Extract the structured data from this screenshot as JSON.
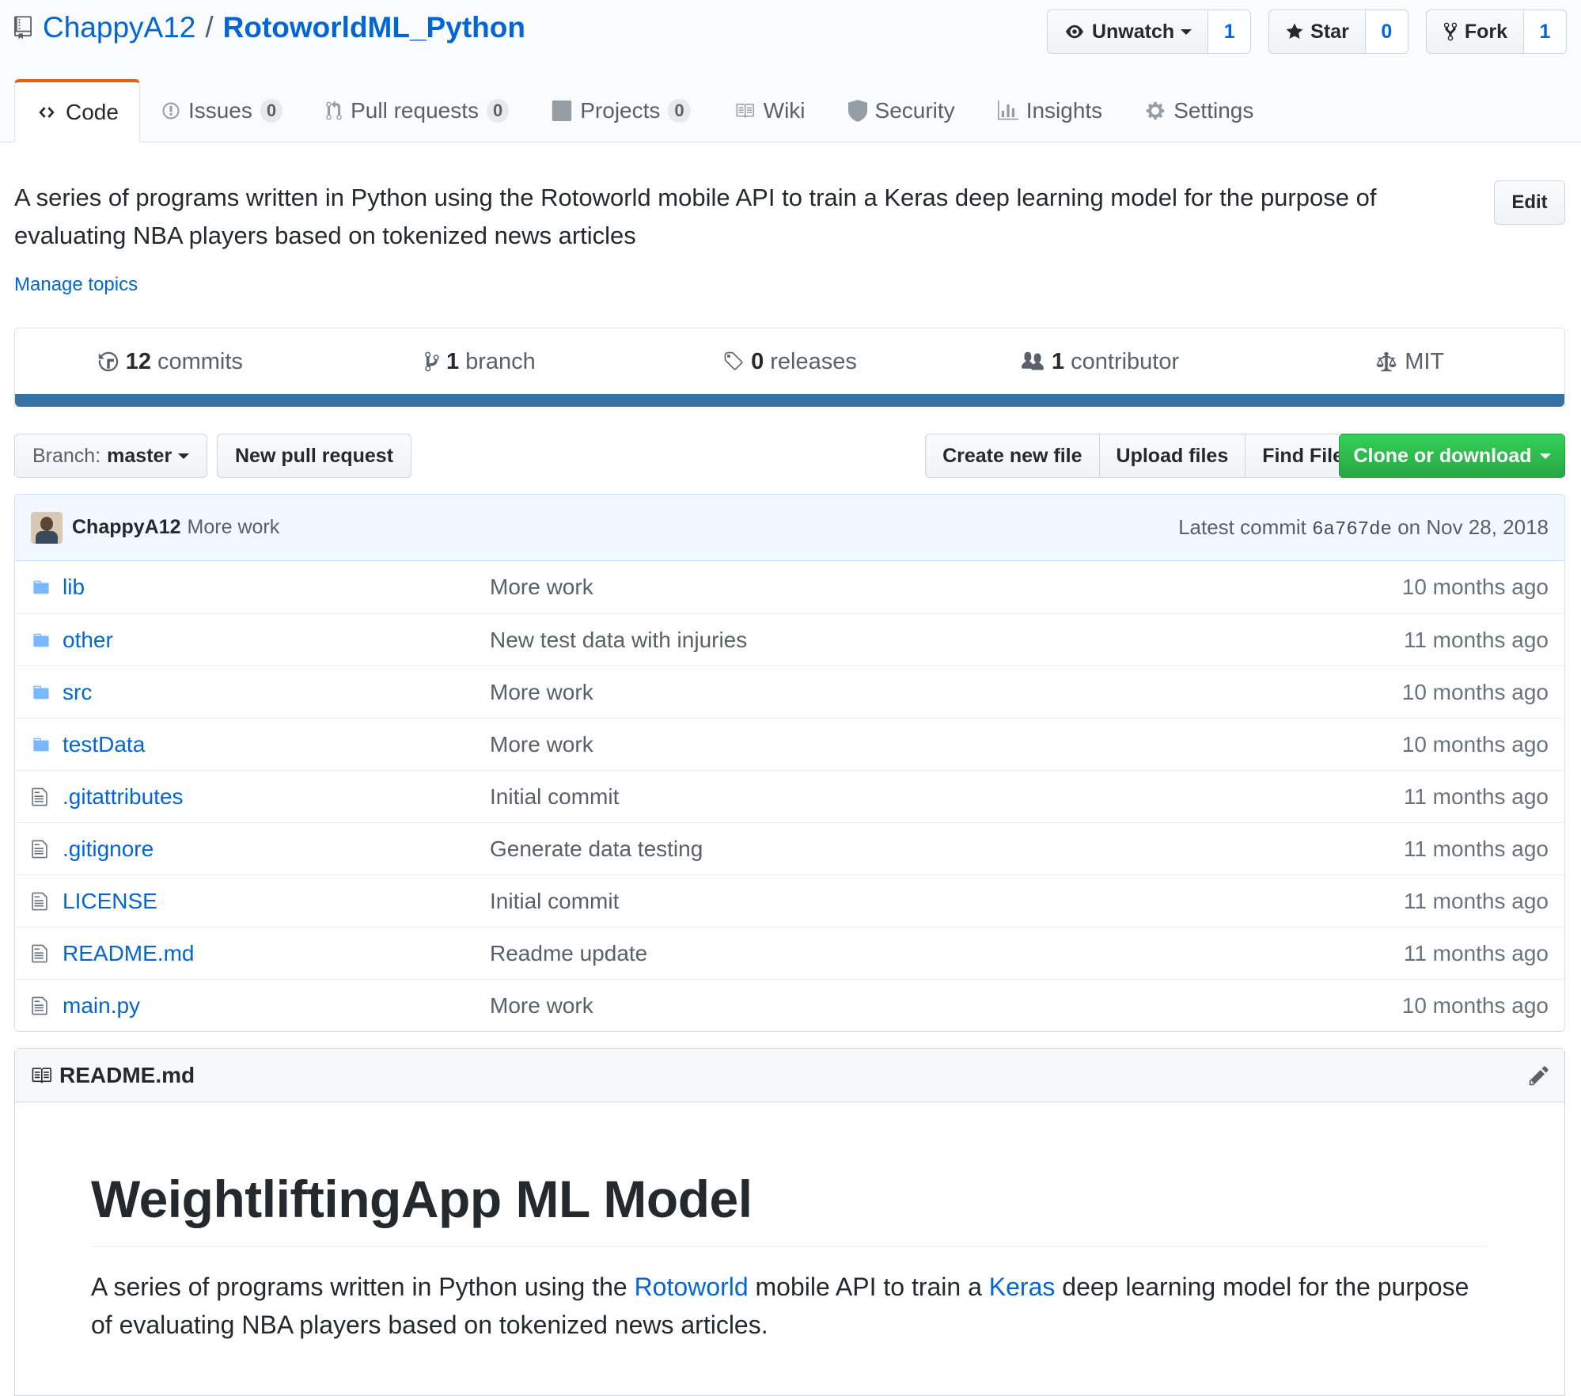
{
  "repo": {
    "owner": "ChappyA12",
    "separator": "/",
    "name": "RotoworldML_Python"
  },
  "actions": {
    "watch": {
      "label": "Unwatch",
      "count": "1"
    },
    "star": {
      "label": "Star",
      "count": "0"
    },
    "fork": {
      "label": "Fork",
      "count": "1"
    }
  },
  "nav": {
    "code": "Code",
    "issues": "Issues",
    "issues_count": "0",
    "pulls": "Pull requests",
    "pulls_count": "0",
    "projects": "Projects",
    "projects_count": "0",
    "wiki": "Wiki",
    "security": "Security",
    "insights": "Insights",
    "settings": "Settings"
  },
  "description": "A series of programs written in Python using the Rotoworld mobile API to train a Keras deep learning model for the purpose of evaluating NBA players based on tokenized news articles",
  "edit_label": "Edit",
  "manage_topics": "Manage topics",
  "summary": {
    "commits_num": "12",
    "commits_label": "commits",
    "branch_num": "1",
    "branch_label": "branch",
    "releases_num": "0",
    "releases_label": "releases",
    "contributor_num": "1",
    "contributor_label": "contributor",
    "license": "MIT",
    "language_color": "#3572a5"
  },
  "file_nav": {
    "branch_label": "Branch:",
    "branch_name": "master",
    "new_pr": "New pull request",
    "create_file": "Create new file",
    "upload_files": "Upload files",
    "find_file": "Find File",
    "clone": "Clone or download"
  },
  "latest_commit": {
    "author": "ChappyA12",
    "message": "More work",
    "prefix": "Latest commit",
    "sha": "6a767de",
    "date": "on Nov 28, 2018"
  },
  "files": [
    {
      "type": "dir",
      "name": "lib",
      "message": "More work",
      "age": "10 months ago"
    },
    {
      "type": "dir",
      "name": "other",
      "message": "New test data with injuries",
      "age": "11 months ago"
    },
    {
      "type": "dir",
      "name": "src",
      "message": "More work",
      "age": "10 months ago"
    },
    {
      "type": "dir",
      "name": "testData",
      "message": "More work",
      "age": "10 months ago"
    },
    {
      "type": "file",
      "name": ".gitattributes",
      "message": "Initial commit",
      "age": "11 months ago"
    },
    {
      "type": "file",
      "name": ".gitignore",
      "message": "Generate data testing",
      "age": "11 months ago"
    },
    {
      "type": "file",
      "name": "LICENSE",
      "message": "Initial commit",
      "age": "11 months ago"
    },
    {
      "type": "file",
      "name": "README.md",
      "message": "Readme update",
      "age": "11 months ago"
    },
    {
      "type": "file",
      "name": "main.py",
      "message": "More work",
      "age": "10 months ago"
    }
  ],
  "readme": {
    "filename": "README.md",
    "heading": "WeightliftingApp ML Model",
    "p_part1": "A series of programs written in Python using the ",
    "link1": "Rotoworld",
    "p_part2": " mobile API to train a ",
    "link2": "Keras",
    "p_part3": " deep learning model for the purpose of evaluating NBA players based on tokenized news articles."
  }
}
